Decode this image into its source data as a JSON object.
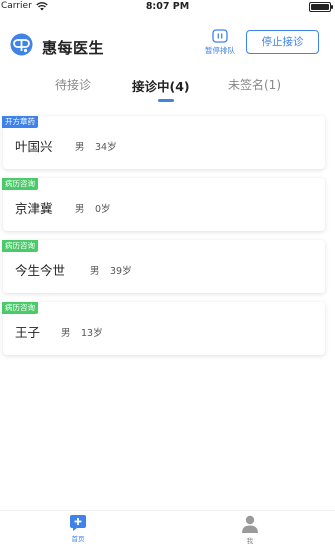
{
  "status_bar": {
    "carrier": "Carrier",
    "time": "8:07 PM",
    "battery_level": 1.0
  },
  "header": {
    "title": "惠每医生",
    "pause_label": "暂停排队",
    "stop_label": "停止接诊",
    "logo_icon": "doctor-app-logo",
    "pause_icon": "pause-icon"
  },
  "tabs": [
    {
      "label": "待接诊",
      "active": false
    },
    {
      "label": "接诊中(4)",
      "active": true
    },
    {
      "label": "未签名(1)",
      "active": false
    }
  ],
  "patients": [
    {
      "tag": "开方章药",
      "tag_color": "#3e82ea",
      "name": "叶国兴",
      "gender": "男",
      "age": "34岁"
    },
    {
      "tag": "病历咨询",
      "tag_color": "#4cc96b",
      "name": "京津冀",
      "gender": "男",
      "age": "0岁"
    },
    {
      "tag": "病历咨询",
      "tag_color": "#4cc96b",
      "name": "今生今世",
      "gender": "男",
      "age": "39岁"
    },
    {
      "tag": "病历咨询",
      "tag_color": "#4cc96b",
      "name": "王子",
      "gender": "男",
      "age": "13岁"
    }
  ],
  "tab_bar": [
    {
      "label": "首页",
      "icon": "home-plus-icon",
      "active": true
    },
    {
      "label": "我",
      "icon": "person-icon",
      "active": false
    }
  ],
  "colors": {
    "accent": "#3e82ea",
    "consult_tag": "#4cc96b",
    "inactive": "#888888"
  }
}
